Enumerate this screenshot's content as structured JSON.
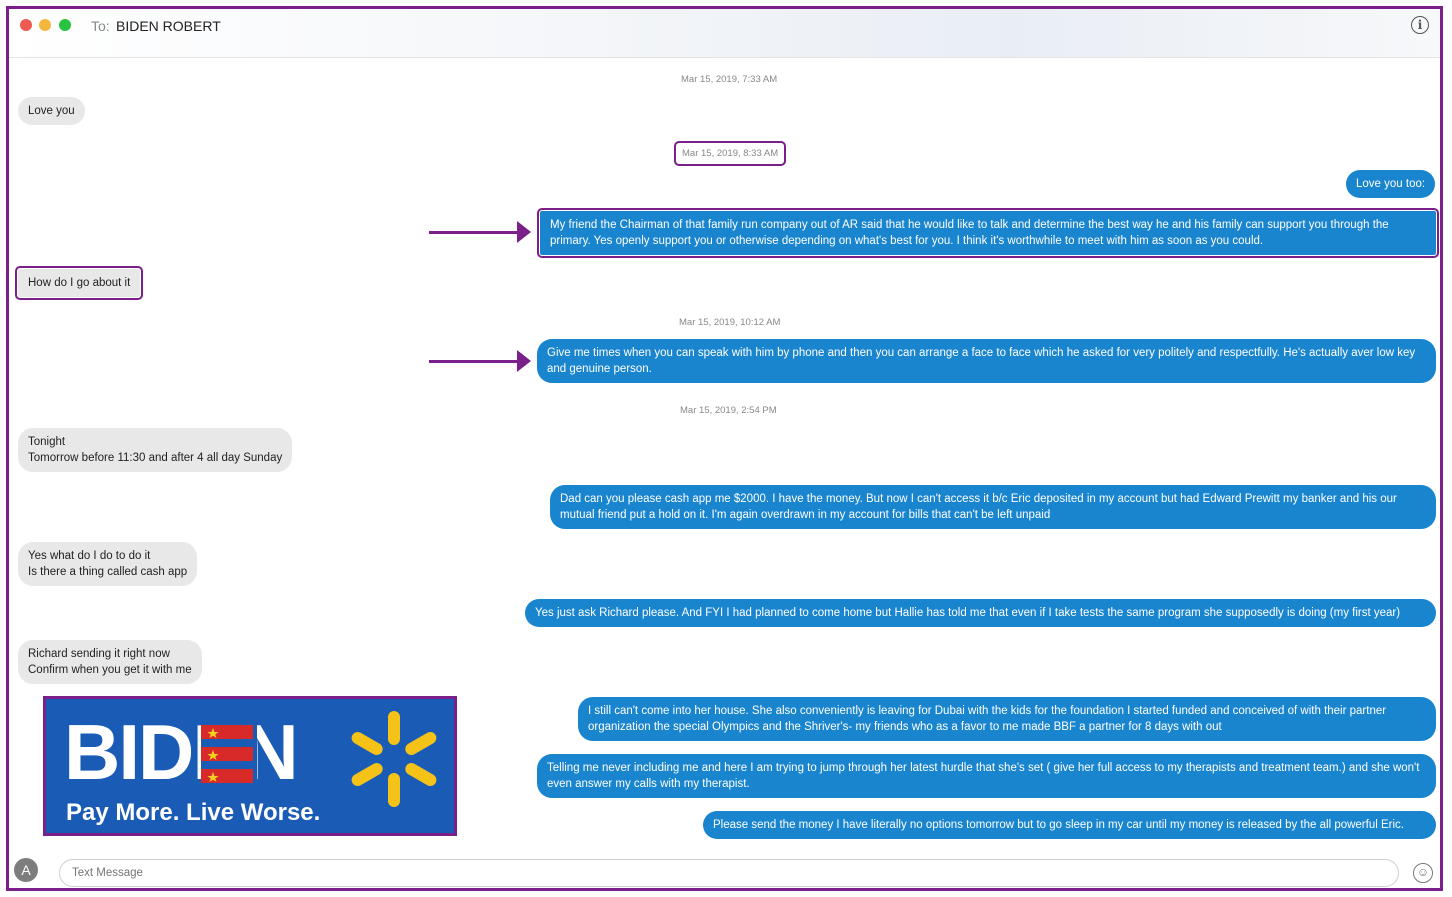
{
  "header": {
    "to_label": "To:",
    "recipient": "BIDEN ROBERT",
    "info_icon": "info-icon"
  },
  "timestamps": {
    "t1": "Mar 15, 2019, 7:33 AM",
    "t2": "Mar 15, 2019, 8:33 AM",
    "t3": "Mar 15, 2019, 10:12 AM",
    "t4": "Mar 15, 2019, 2:54 PM"
  },
  "messages": {
    "m1": "Love you",
    "m2": "Love you too:",
    "m3": "My friend the Chairman of that family run company out of AR said that he would like to talk and determine the best way he and his family can support you through the primary. Yes openly support you or otherwise depending on what's best for you. I think it's worthwhile to meet with him as soon as you could.",
    "m4": "How do I go about it",
    "m5": "Give me times when you can speak with him by phone and then you can arrange a face to face which he asked for very politely and respectfully. He's actually aver low key and genuine person.",
    "m6_line1": "Tonight",
    "m6_line2": "Tomorrow before 11:30 and after 4 all day Sunday",
    "m7": "Dad can you please cash app me $2000. I have the money. But now I can't access it b/c Eric deposited in my account but had Edward Prewitt my banker and his our mutual friend put a hold on it. I'm again overdrawn in my account for bills that can't be left unpaid",
    "m8_line1": "Yes what do I do to do it",
    "m8_line2": "Is there a thing called cash app",
    "m9": "Yes just ask Richard please. And FYI I had planned to come home but Hallie has told me that even if I take tests the same program she supposedly is doing (my first year)",
    "m10_line1": "Richard sending it right now",
    "m10_line2": "Confirm when you get it with me",
    "m11": "I still can't come into her house. She also conveniently is leaving for Dubai with the kids for the foundation I started funded and conceived of with their partner organization the special Olympics and the Shriver's- my friends who as a favor to me made BBF a partner for 8 days with out",
    "m12": "Telling me never including me and here I am trying to jump through her latest hurdle that she's set ( give her full access to my therapists and treatment team.) and she won't even answer my calls with my therapist.",
    "m13": "Please send the money I have literally no options tomorrow but to go sleep in my car until my money is released by the all powerful Eric."
  },
  "image": {
    "title": "BIDEN",
    "subtitle": "Pay More.  Live Worse."
  },
  "composer": {
    "placeholder": "Text Message",
    "apps_icon": "app-store-icon",
    "emoji_icon": "emoji-icon"
  },
  "colors": {
    "accent_outline": "#7b1f8a",
    "sent_bubble": "#1a85cf",
    "received_bubble": "#e8e8e8",
    "meme_bg": "#1a5bb5",
    "spark": "#f5c218"
  }
}
